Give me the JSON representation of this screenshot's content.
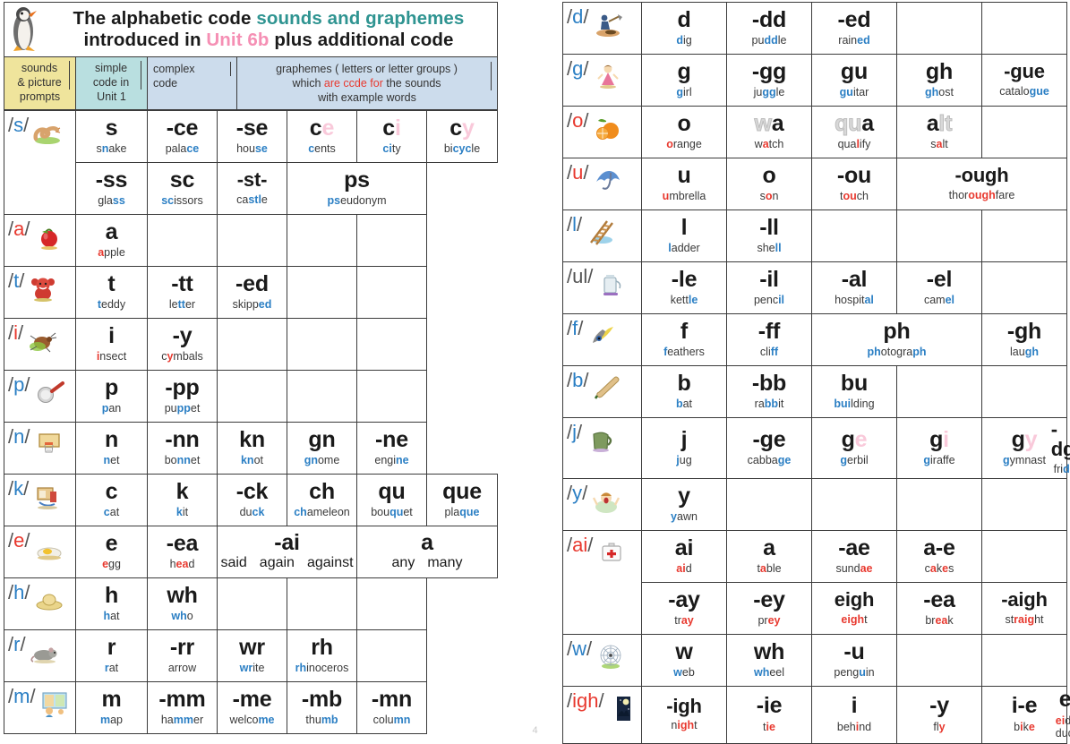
{
  "title": {
    "line1_a": "The alphabetic code ",
    "line1_b": "sounds and graphemes",
    "line2_a": "introduced in ",
    "line2_b": "Unit 6b",
    "line2_c": " plus additional code",
    "penguin_icon": "penguin-icon"
  },
  "header": {
    "col1": "sounds\n& picture\nprompts",
    "col1_lines": [
      "sounds",
      "& picture",
      "prompts"
    ],
    "col2_lines": [
      "simple",
      "code in",
      "Unit 1"
    ],
    "col3_lines": [
      "complex",
      "code"
    ],
    "col4_line1": "graphemes  ( letters or letter groups )",
    "col4_line2_a": "which ",
    "col4_line2_b": "are ccde for",
    "col4_line2_c": " the sounds",
    "col4_line3": "with example words"
  },
  "colors": {
    "cyan": "#cfe6ec",
    "blue": "#c3d3e8",
    "pink": "#f4a8c4",
    "pink_light": "#ecc9dd",
    "olive": "#ccd97a",
    "olive_light": "#e2eaae",
    "purple": "#c9a8cc",
    "purple_light": "#cbb4dd",
    "gold": "#f5d05a",
    "header_yellow": "#efe49c",
    "header_teal": "#b9dfe0",
    "header_blue": "#ccdcec",
    "title_teal": "#2f9491",
    "title_pink": "#f58fb4",
    "word_blue": "#2b7fc4",
    "word_red": "#e8392f"
  },
  "page_number": "4",
  "left_table": {
    "rows": [
      {
        "sound": "/s/",
        "sound_color": "blue",
        "picture": "snake-icon",
        "rowspan": 2,
        "cells": [
          {
            "graph": "s",
            "word": "snake",
            "hl": "b:1",
            "bg": "cyan"
          },
          {
            "graph": "-ce",
            "word": "palace",
            "hl": "b:4-6",
            "bg": "blue"
          },
          {
            "graph": "-se",
            "word": "house",
            "hl": "b:3-5",
            "bg": "blue"
          },
          {
            "graph": "ce",
            "ghost": "e",
            "word": "cents",
            "hl": "b:0",
            "bg": "pink"
          },
          {
            "graph": "ci",
            "ghost": "i",
            "word": "city",
            "hl": "b:0-1",
            "bg": "pink"
          },
          {
            "graph": "cy",
            "ghost": "y",
            "word": "bicycle",
            "hl": "b:2-4",
            "bg": "pink"
          }
        ],
        "cells2": [
          {
            "graph": "-ss",
            "word": "glass",
            "hl": "b:3-5",
            "bg": "olive"
          },
          {
            "graph": "sc",
            "word": "scissors",
            "hl": "b:0-1",
            "bg": "white"
          },
          {
            "graph": "-st-",
            "word": "castle",
            "hl": "b:2-4",
            "bg": "pink_light"
          },
          {
            "graph": "ps",
            "word": "pseudonym",
            "hl": "b:0-1",
            "bg": "white",
            "span": 2
          }
        ]
      },
      {
        "sound": "/a/",
        "sound_color": "red",
        "picture": "apple-icon",
        "cells": [
          {
            "graph": "a",
            "word": "apple",
            "hl": "r:0",
            "bg": "cyan"
          },
          {
            "empty": true
          },
          {
            "empty": true
          },
          {
            "empty": true
          },
          {
            "empty": true
          }
        ]
      },
      {
        "sound": "/t/",
        "sound_color": "blue",
        "picture": "teddy-icon",
        "cells": [
          {
            "graph": "t",
            "word": "teddy",
            "hl": "b:0",
            "bg": "cyan"
          },
          {
            "graph": "-tt",
            "word": "letter",
            "hl": "b:2-3",
            "bg": "white"
          },
          {
            "graph": "-ed",
            "word": "skipped",
            "hl": "b:5-6",
            "bg": "white"
          },
          {
            "empty": true
          },
          {
            "empty": true
          }
        ]
      },
      {
        "sound": "/i/",
        "sound_color": "red",
        "picture": "insect-icon",
        "cells": [
          {
            "graph": "i",
            "word": "insect",
            "hl": "r:0",
            "bg": "cyan"
          },
          {
            "graph": "-y",
            "word": "cymbals",
            "hl": "y:1",
            "bg": "white"
          },
          {
            "empty": true
          },
          {
            "empty": true
          },
          {
            "empty": true
          }
        ]
      },
      {
        "sound": "/p/",
        "sound_color": "blue",
        "picture": "pan-icon",
        "cells": [
          {
            "graph": "p",
            "word": "pan",
            "hl": "b:0",
            "bg": "cyan"
          },
          {
            "graph": "-pp",
            "word": "puppet",
            "hl": "b:2-3",
            "bg": "white"
          },
          {
            "empty": true
          },
          {
            "empty": true
          },
          {
            "empty": true
          }
        ]
      },
      {
        "sound": "/n/",
        "sound_color": "blue",
        "picture": "net-icon",
        "cells": [
          {
            "graph": "n",
            "word": "net",
            "hl": "b:0",
            "bg": "cyan"
          },
          {
            "graph": "-nn",
            "word": "bonnet",
            "hl": "b:2-3",
            "bg": "white"
          },
          {
            "graph": "kn",
            "word": "knot",
            "hl": "b:0-1",
            "bg": "pink_light"
          },
          {
            "graph": "gn",
            "word": "gnome",
            "hl": "b:0-1",
            "bg": "white"
          },
          {
            "graph": "-ne",
            "word": "engine",
            "hl": "b:4-5",
            "bg": "white"
          }
        ]
      },
      {
        "sound": "/k/",
        "sound_color": "blue",
        "picture": "kit-icon",
        "cells": [
          {
            "graph": "c",
            "word": "cat",
            "hl": "b:0",
            "bg": "cyan"
          },
          {
            "graph": "k",
            "word": "kit",
            "hl": "b:0",
            "bg": "cyan"
          },
          {
            "graph": "-ck",
            "word": "duck",
            "hl": "b:2-3",
            "bg": "cyan"
          },
          {
            "graph": "ch",
            "word": "chameleon",
            "hl": "b:0-1",
            "bg": "pink_light"
          },
          {
            "graph": "qu",
            "word": "bouquet",
            "hl": "b:3-4",
            "bg": "white"
          },
          {
            "graph": "que",
            "word": "plaque",
            "hl": "b:3-5",
            "bg": "white"
          }
        ]
      },
      {
        "sound": "/e/",
        "sound_color": "red",
        "picture": "egg-icon",
        "cells": [
          {
            "graph": "e",
            "word": "egg",
            "hl": "r:0",
            "bg": "cyan"
          },
          {
            "graph": "-ea",
            "word": "head",
            "hl": "r:1-2",
            "bg": "purple"
          },
          {
            "graph": "-ai",
            "words": [
              "said",
              "again",
              "against"
            ],
            "bg": "white",
            "span": 2
          },
          {
            "graph": "a",
            "words": [
              "any",
              "many"
            ],
            "bg": "white",
            "span": 2
          }
        ]
      },
      {
        "sound": "/h/",
        "sound_color": "blue",
        "picture": "hat-icon",
        "cells": [
          {
            "graph": "h",
            "word": "hat",
            "hl": "b:0",
            "bg": "cyan"
          },
          {
            "graph": "wh",
            "word": "who",
            "hl": "b:0-1",
            "bg": "white"
          },
          {
            "empty": true
          },
          {
            "empty": true
          },
          {
            "empty": true
          }
        ]
      },
      {
        "sound": "/r/",
        "sound_color": "blue",
        "picture": "rat-icon",
        "cells": [
          {
            "graph": "r",
            "word": "rat",
            "hl": "b:0",
            "bg": "cyan"
          },
          {
            "graph": "-rr",
            "word": "arrow",
            "hl": "none",
            "bg": "white"
          },
          {
            "graph": "wr",
            "word": "write",
            "hl": "b:0-1",
            "bg": "pink_light"
          },
          {
            "graph": "rh",
            "word": "rhinoceros",
            "hl": "b:0-1",
            "bg": "white"
          },
          {
            "empty": true
          }
        ]
      },
      {
        "sound": "/m/",
        "sound_color": "blue",
        "picture": "map-icon",
        "cells": [
          {
            "graph": "m",
            "word": "map",
            "hl": "b:0",
            "bg": "olive"
          },
          {
            "graph": "-mm",
            "word": "hammer",
            "hl": "b:2-3",
            "bg": "white"
          },
          {
            "graph": "-me",
            "word": "welcome",
            "hl": "b:5-6",
            "bg": "white"
          },
          {
            "graph": "-mb",
            "word": "thumb",
            "hl": "b:3-4",
            "bg": "pink_light"
          },
          {
            "graph": "-mn",
            "word": "column",
            "hl": "b:4-5",
            "bg": "white"
          }
        ]
      }
    ]
  },
  "right_table": {
    "rows": [
      {
        "sound": "/d/",
        "sound_color": "blue",
        "picture": "digging-icon",
        "cells": [
          {
            "graph": "d",
            "word": "dig",
            "hl": "b:0",
            "bg": "olive"
          },
          {
            "graph": "-dd",
            "word": "puddle",
            "hl": "b:2-3",
            "bg": "white"
          },
          {
            "graph": "-ed",
            "word": "rained",
            "hl": "b:4-5",
            "bg": "white"
          },
          {
            "empty": true
          },
          {
            "empty": true
          }
        ]
      },
      {
        "sound": "/g/",
        "sound_color": "blue",
        "picture": "girl-icon",
        "cells": [
          {
            "graph": "g",
            "word": "girl",
            "hl": "b:0",
            "bg": "olive"
          },
          {
            "graph": "-gg",
            "word": "juggle",
            "hl": "b:2-3",
            "bg": "white"
          },
          {
            "graph": "gu",
            "word": "guitar",
            "hl": "b:0-1",
            "bg": "white"
          },
          {
            "graph": "gh",
            "word": "ghost",
            "hl": "b:0-1",
            "bg": "white"
          },
          {
            "graph": "-gue",
            "word": "catalogue",
            "hl": "b:6-8",
            "bg": "white"
          }
        ]
      },
      {
        "sound": "/o/",
        "sound_color": "red",
        "picture": "orange-icon",
        "cells": [
          {
            "graph": "o",
            "word": "orange",
            "hl": "r:0",
            "bg": "olive"
          },
          {
            "graph": "wa",
            "ghost_pre": "w",
            "word": "watch",
            "hl": "r:1",
            "bg": "white"
          },
          {
            "graph": "qua",
            "ghost_pre": "qu",
            "word": "qualify",
            "hl": "r:3",
            "bg": "white"
          },
          {
            "graph": "alt",
            "ghost_post": "lt",
            "word": "salt",
            "hl": "r:1",
            "bg": "white"
          },
          {
            "empty": true
          }
        ]
      },
      {
        "sound": "/u/",
        "sound_color": "red",
        "picture": "umbrella-icon",
        "cells": [
          {
            "graph": "u",
            "word": "umbrella",
            "hl": "r:0",
            "bg": "olive"
          },
          {
            "graph": "o",
            "word": "son",
            "hl": "r:1",
            "bg": "olive_light"
          },
          {
            "graph": "-ou",
            "word": "touch",
            "hl": "r:1-2",
            "bg": "white"
          },
          {
            "graph": "-ough",
            "word": "thoroughfare",
            "hl": "r:4-7",
            "bg": "white",
            "span": 2
          }
        ]
      },
      {
        "sound": "/l/",
        "sound_color": "blue",
        "picture": "ladder-icon",
        "cells": [
          {
            "graph": "l",
            "word": "ladder",
            "hl": "b:0",
            "bg": "olive"
          },
          {
            "graph": "-ll",
            "word": "shell",
            "hl": "b:3-4",
            "bg": "olive"
          },
          {
            "empty": true
          },
          {
            "empty": true
          },
          {
            "empty": true
          }
        ]
      },
      {
        "sound": "/ul/",
        "sound_color": "greyblue",
        "picture": "kettle-icon",
        "cells": [
          {
            "graph": "-le",
            "word": "kettle",
            "hl": "b:4-5",
            "bg": "olive_light"
          },
          {
            "graph": "-il",
            "word": "pencil",
            "hl": "b:4-5",
            "bg": "white"
          },
          {
            "graph": "-al",
            "word": "hospital",
            "hl": "b:6-7",
            "bg": "white"
          },
          {
            "graph": "-el",
            "word": "camel",
            "hl": "b:3-4",
            "bg": "white"
          },
          {
            "empty": true
          }
        ]
      },
      {
        "sound": "/f/",
        "sound_color": "blue",
        "picture": "feathers-icon",
        "cells": [
          {
            "graph": "f",
            "word": "feathers",
            "hl": "b:0",
            "bg": "olive"
          },
          {
            "graph": "-ff",
            "word": "cliff",
            "hl": "b:3-4",
            "bg": "olive"
          },
          {
            "graph": "ph",
            "word": "photograph",
            "hl": "b:0-1,8-9",
            "bg": "gold",
            "span": 2
          },
          {
            "graph": "-gh",
            "word": "laugh",
            "hl": "b:3-4",
            "bg": "white"
          }
        ]
      },
      {
        "sound": "/b/",
        "sound_color": "blue",
        "picture": "bat-icon",
        "cells": [
          {
            "graph": "b",
            "word": "bat",
            "hl": "b:0",
            "bg": "olive"
          },
          {
            "graph": "-bb",
            "word": "rabbit",
            "hl": "b:2-3",
            "bg": "white"
          },
          {
            "graph": "bu",
            "word": "building",
            "hl": "b:0-2",
            "bg": "white"
          },
          {
            "empty": true
          },
          {
            "empty": true
          }
        ]
      },
      {
        "sound": "/j/",
        "sound_color": "blue",
        "picture": "jug-icon",
        "cells": [
          {
            "graph": "j",
            "word": "jug",
            "hl": "b:0",
            "bg": "olive"
          },
          {
            "graph": "-ge",
            "word": "cabbage",
            "hl": "b:5-6",
            "bg": "blue"
          },
          {
            "graph": "ge",
            "ghost": "e",
            "word": "gerbil",
            "hl": "b:0",
            "bg": "pink"
          },
          {
            "graph": "gi",
            "ghost": "i",
            "word": "giraffe",
            "hl": "b:0",
            "bg": "pink"
          },
          {
            "graph": "gy",
            "ghost": "y",
            "word": "gymnast",
            "hl": "b:0",
            "bg": "pink"
          },
          {
            "graph": "-dge",
            "word": "fridge",
            "hl": "b:3-5",
            "bg": "white"
          }
        ]
      },
      {
        "sound": "/y/",
        "sound_color": "blue",
        "picture": "yawn-icon",
        "cells": [
          {
            "graph": "y",
            "word": "yawn",
            "hl": "b:0",
            "bg": "olive"
          },
          {
            "empty": true
          },
          {
            "empty": true
          },
          {
            "empty": true
          },
          {
            "empty": true
          }
        ]
      },
      {
        "sound": "/ai/",
        "sound_color": "red",
        "picture": "aid-icon",
        "rowspan": 2,
        "cells": [
          {
            "graph": "ai",
            "word": "aid",
            "hl": "r:0-1",
            "bg": "olive_light"
          },
          {
            "graph": "a",
            "word": "table",
            "hl": "r:1",
            "bg": "olive_light"
          },
          {
            "graph": "-ae",
            "word": "sundae",
            "hl": "r:4-5",
            "bg": "pink"
          },
          {
            "graph": "a-e",
            "word": "cakes",
            "hl": "r:1,3",
            "bg": "pink"
          },
          {
            "empty": true
          },
          {
            "empty": true
          }
        ],
        "cells2": [
          {
            "graph": "-ay",
            "word": "tray",
            "hl": "r:2-3",
            "bg": "olive_light"
          },
          {
            "graph": "-ey",
            "word": "prey",
            "hl": "r:2-3",
            "bg": "white"
          },
          {
            "graph": "eigh",
            "word": "eight",
            "hl": "r:0-3",
            "bg": "white"
          },
          {
            "graph": "-ea",
            "word": "break",
            "hl": "r:2-3",
            "bg": "white"
          },
          {
            "graph": "-aigh",
            "word": "straight",
            "hl": "r:2-5",
            "bg": "white",
            "span": 2
          }
        ]
      },
      {
        "sound": "/w/",
        "sound_color": "blue",
        "picture": "web-icon",
        "cells": [
          {
            "graph": "w",
            "word": "web",
            "hl": "b:0",
            "bg": "olive_light"
          },
          {
            "graph": "wh",
            "word": "wheel",
            "hl": "b:0-1",
            "bg": "purple_light"
          },
          {
            "graph": "-u",
            "word": "penguin",
            "hl": "b:4",
            "bg": "white"
          },
          {
            "empty": true
          },
          {
            "empty": true
          }
        ]
      },
      {
        "sound": "/igh/",
        "sound_color": "red",
        "picture": "night-icon",
        "cells": [
          {
            "graph": "-igh",
            "word": "night",
            "hl": "r:1-3",
            "bg": "olive_light"
          },
          {
            "graph": "-ie",
            "word": "tie",
            "hl": "r:1-2",
            "bg": "olive_light"
          },
          {
            "graph": "i",
            "word": "behind",
            "hl": "r:3",
            "bg": "white"
          },
          {
            "graph": "-y",
            "word": "fly",
            "hl": "y:2",
            "bg": "olive_light"
          },
          {
            "graph": "i-e",
            "word": "bike",
            "hl": "r:1,3",
            "bg": "pink"
          },
          {
            "graph": "ei",
            "word": "eider duck",
            "hl": "r:0-1",
            "bg": "white"
          }
        ]
      }
    ]
  }
}
